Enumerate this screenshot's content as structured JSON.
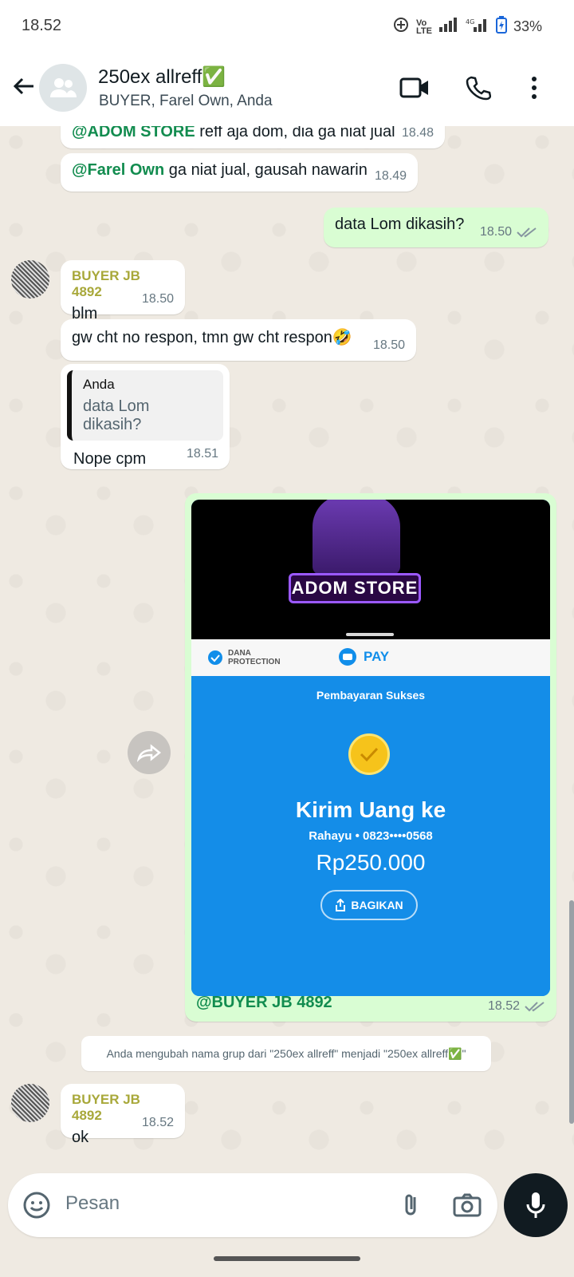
{
  "status_bar": {
    "time": "18.52",
    "battery": "33%"
  },
  "header": {
    "title": "250ex allreff✅",
    "subtitle": "BUYER, Farel Own, Anda"
  },
  "messages": [
    {
      "mention": "@ADOM STORE",
      "text": " reff aja dom, dia ga niat jual",
      "time": "18.48"
    },
    {
      "mention": "@Farel Own",
      "text": " ga niat jual, gausah nawarin",
      "time": "18.49"
    },
    {
      "text": "data Lom dikasih?",
      "time": "18.50"
    },
    {
      "sender": "BUYER JB 4892",
      "text": "blm",
      "time": "18.50"
    },
    {
      "text": "gw cht no respon, tmn gw cht respon🤣",
      "time": "18.50"
    },
    {
      "quote_name": "Anda",
      "quote_text": "data Lom dikasih?",
      "text": "Nope cpm",
      "time": "18.51"
    },
    {
      "caption": "@BUYER JB 4892",
      "time": "18.52"
    },
    {
      "sender": "BUYER JB 4892",
      "text": "ok",
      "time": "18.52"
    }
  ],
  "image": {
    "store_label": "ADOM STORE",
    "dana_label_1": "DANA",
    "dana_label_2": "PROTECTION",
    "pay_label": "PAY",
    "status": "Pembayaran Sukses",
    "headline": "Kirim Uang ke",
    "recipient": "Rahayu • 0823••••0568",
    "amount": "Rp250.000",
    "share_label": "BAGIKAN"
  },
  "system_message": "Anda mengubah nama grup dari \"250ex allreff\" menjadi \"250ex allreff✅\"",
  "input": {
    "placeholder": "Pesan"
  },
  "colors": {
    "outgoing": "#d9fdd3",
    "mention": "#128c4f",
    "sender": "#a8a83a",
    "dana_blue": "#148de8"
  }
}
